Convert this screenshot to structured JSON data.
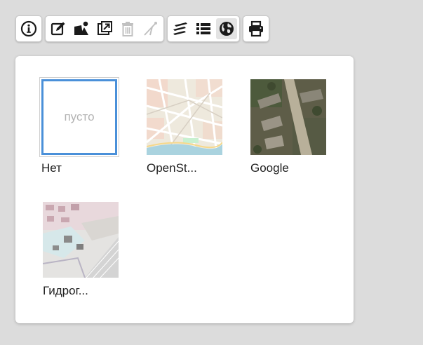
{
  "toolbar": {
    "groups": [
      [
        {
          "icon": "info-icon"
        }
      ],
      [
        {
          "icon": "edit-icon"
        },
        {
          "icon": "shape-edit-icon"
        },
        {
          "icon": "external-link-icon"
        },
        {
          "icon": "trash-icon",
          "disabled": true
        },
        {
          "icon": "measure-icon",
          "disabled": true
        }
      ],
      [
        {
          "icon": "layers-icon"
        },
        {
          "icon": "list-icon"
        },
        {
          "icon": "globe-icon",
          "active": true
        }
      ],
      [
        {
          "icon": "print-icon"
        }
      ]
    ]
  },
  "basemaps": {
    "items": [
      {
        "label": "Нет",
        "empty_text": "пусто",
        "selected": true
      },
      {
        "label": "OpenSt..."
      },
      {
        "label": "Google"
      },
      {
        "label": "Гидрог..."
      }
    ]
  },
  "colors": {
    "background": "#dcdcdc",
    "selection": "#4a90d9"
  }
}
